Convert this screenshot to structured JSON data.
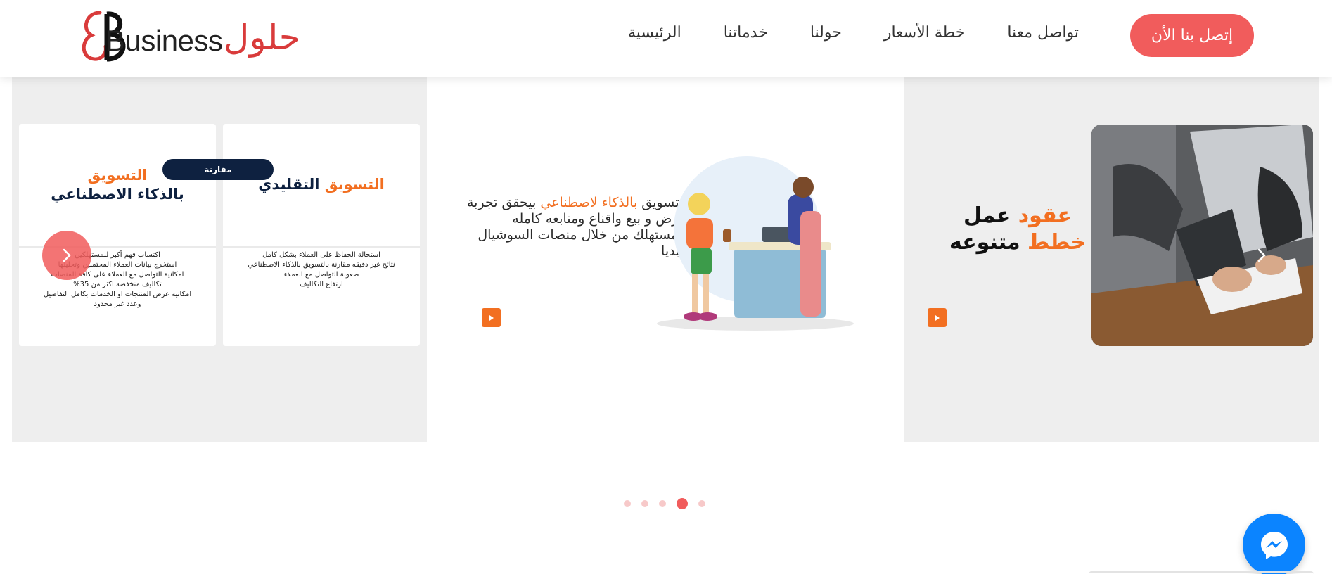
{
  "header": {
    "logo_text": "Business",
    "logo_arabic": "حلول",
    "nav": [
      {
        "label": "الرئيسية"
      },
      {
        "label": "خدماتنا"
      },
      {
        "label": "حولنا"
      },
      {
        "label": "خطة الأسعار"
      },
      {
        "label": "تواصل معنا"
      }
    ],
    "cta_label": "إتصل بنا الأن"
  },
  "slider": {
    "left": {
      "pill_label": "مقارنة",
      "card_traditional": {
        "title_orange": "التسويق",
        "title_dark": "التقليدي",
        "items": [
          "استحالة الحفاظ على العملاء بشكل كامل",
          "نتائج غير دقيقه مقارنة بالتسويق بالذكاء الاصطناعي",
          "صعوبة التواصل مع العملاء",
          "ارتفاع التكاليف"
        ]
      },
      "card_ai": {
        "title_orange": "التسويق",
        "title_dark": "بالذكاء الاصطناعي",
        "items": [
          "اكتساب فهم أكبر للمستهلكين",
          "استخرج بيانات العملاء المحتملين وتحليلها",
          "امكانية التواصل مع العملاء على كافة المنصات",
          "تكاليف منخفضه اكثر من 35%",
          "امكانية عرض المنتجات او الخدمات  بكامل التفاصيل",
          "وعدد غير محدود"
        ]
      }
    },
    "center": {
      "text_part1": "التسويق ",
      "text_highlight": "بالذكاء لاصطناعي",
      "text_part2": " بيحقق تجربة عرض و بيع واقناع ومتابعه كامله  للمستهلك من خلال منصات السوشيال ميديا"
    },
    "right": {
      "line1_orange": "عقود",
      "line1_dark": " عمل",
      "line2_orange": "خطط",
      "line2_dark": " متنوعه"
    },
    "dots_count": 5,
    "active_dot": 3
  },
  "colors": {
    "accent": "#f15c5c",
    "orange": "#f26f21",
    "navy": "#0e2140",
    "messenger": "#0b84ff"
  },
  "icons": {
    "prev": "chevron-left-icon",
    "next": "chevron-right-icon",
    "play": "play-icon",
    "messenger": "messenger-icon"
  }
}
